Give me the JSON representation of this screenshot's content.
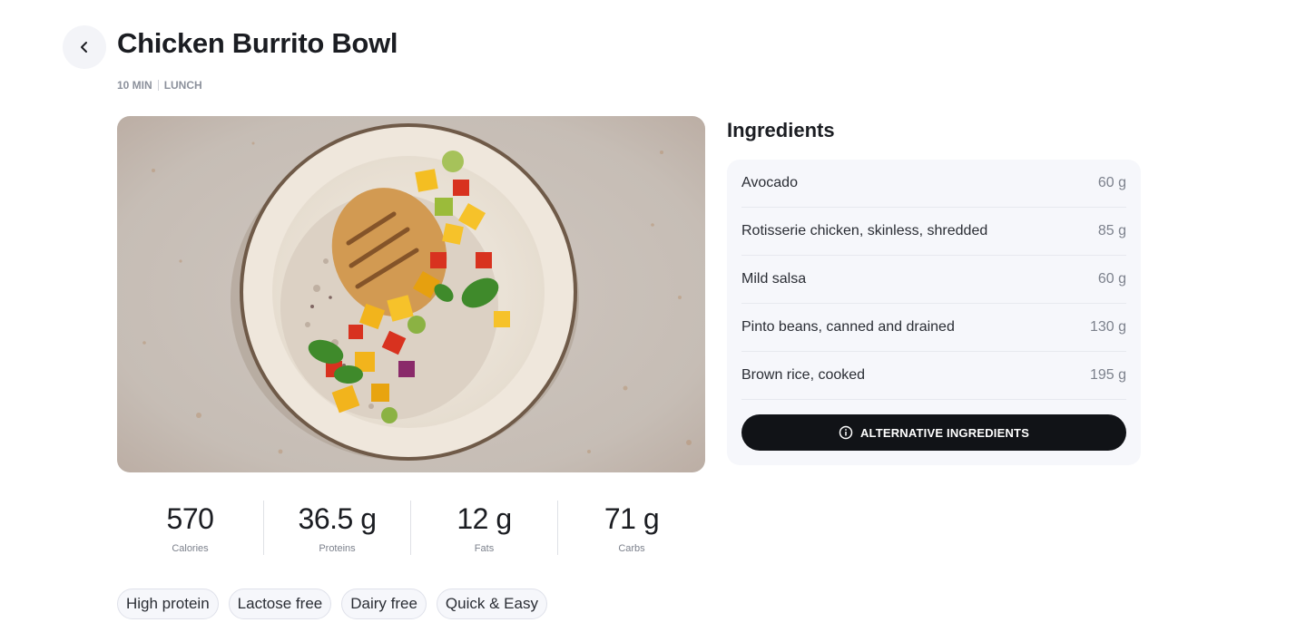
{
  "header": {
    "back_icon": "chevron-left-icon",
    "title": "Chicken Burrito Bowl",
    "time": "10 MIN",
    "meal": "LUNCH"
  },
  "photo": {
    "description_icon": "food-photo"
  },
  "ingredients": {
    "title": "Ingredients",
    "items": [
      {
        "name": "Avocado",
        "qty": "60 g"
      },
      {
        "name": "Rotisserie chicken, skinless, shredded",
        "qty": "85 g"
      },
      {
        "name": "Mild salsa",
        "qty": "60 g"
      },
      {
        "name": "Pinto beans, canned and drained",
        "qty": "130 g"
      },
      {
        "name": "Brown rice, cooked",
        "qty": "195 g"
      }
    ],
    "alt_button_label": "ALTERNATIVE INGREDIENTS",
    "alt_button_icon": "info-icon"
  },
  "macros": [
    {
      "value": "570",
      "label": "Calories"
    },
    {
      "value": "36.5 g",
      "label": "Proteins"
    },
    {
      "value": "12 g",
      "label": "Fats"
    },
    {
      "value": "71 g",
      "label": "Carbs"
    }
  ],
  "tags": [
    "High protein",
    "Lactose free",
    "Dairy free",
    "Quick & Easy"
  ],
  "colors": {
    "accent_dark": "#111317",
    "card_bg": "#f6f7fb",
    "muted_text": "#7c818c"
  }
}
